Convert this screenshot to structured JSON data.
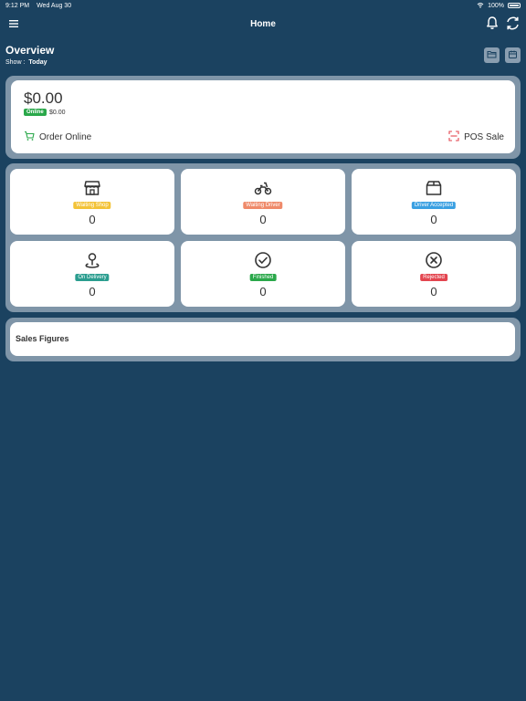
{
  "status_bar": {
    "time": "9:12 PM",
    "date": "Wed Aug 30",
    "battery": "100%"
  },
  "header": {
    "title": "Home"
  },
  "overview": {
    "title": "Overview",
    "show_label": "Show :",
    "show_value": "Today"
  },
  "balance": {
    "amount": "$0.00",
    "online_label": "Online",
    "online_value": "$0.00"
  },
  "actions": {
    "order_online": "Order Online",
    "pos_sale": "POS Sale"
  },
  "stats": [
    {
      "label": "Waiting Shop",
      "count": "0",
      "badge_color": "#f3c338",
      "icon": "shop-icon"
    },
    {
      "label": "Waiting Driver",
      "count": "0",
      "badge_color": "#ef8a6a",
      "icon": "motorbike-icon"
    },
    {
      "label": "Driver Accepted",
      "count": "0",
      "badge_color": "#3aa0e2",
      "icon": "box-icon"
    },
    {
      "label": "On Delivery",
      "count": "0",
      "badge_color": "#2a9d8f",
      "icon": "location-pin-icon"
    },
    {
      "label": "Finished",
      "count": "0",
      "badge_color": "#2aa84a",
      "icon": "check-circle-icon"
    },
    {
      "label": "Rejected",
      "count": "0",
      "badge_color": "#e3454f",
      "icon": "x-circle-icon"
    }
  ],
  "sales": {
    "title": "Sales Figures"
  }
}
